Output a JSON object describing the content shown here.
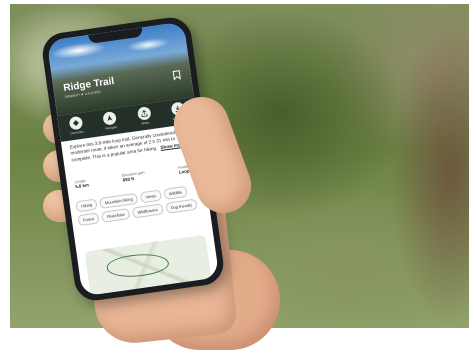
{
  "trail": {
    "title": "Ridge Trail",
    "subtitle": "Adopted • ★ 4.6 (1000)",
    "actions": [
      "Directions",
      "Navigate",
      "Share",
      "Download"
    ],
    "description": "Explore this 3.6-mile loop trail. Generally considered a moderate route, it takes an average of 2 h 31 min to complete. This is a popular area for hiking.",
    "show_more": "Show more",
    "stats": [
      {
        "key": "Length",
        "value": "5.8 km"
      },
      {
        "key": "Elevation gain",
        "value": "693 ft"
      },
      {
        "key": "Route type",
        "value": "Loop"
      }
    ],
    "tags": [
      "Hiking",
      "Mountain biking",
      "Views",
      "Wildlife",
      "Forest",
      "River/lake",
      "Wildflowers",
      "Dog friendly"
    ]
  },
  "colors": {
    "screen_header": "#24312a",
    "trail_line": "#3d7a4a"
  }
}
